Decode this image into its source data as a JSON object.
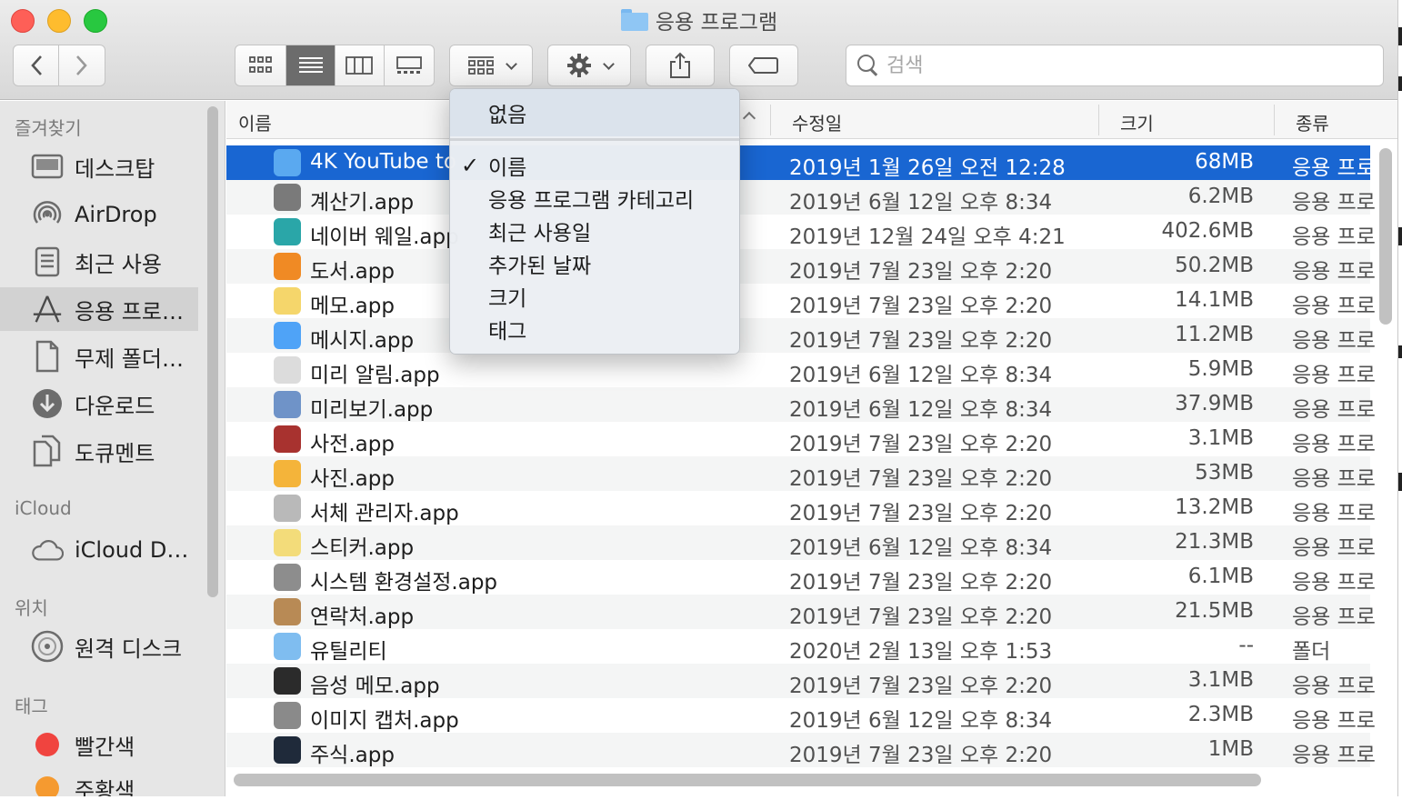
{
  "window": {
    "title": "응용 프로그램"
  },
  "toolbar": {
    "back_label": "‹",
    "forward_label": "›",
    "search_placeholder": "검색"
  },
  "sidebar": {
    "sections": {
      "favorites": "즐겨찾기",
      "icloud": "iCloud",
      "locations": "위치",
      "tags": "태그"
    },
    "favorites": [
      {
        "label": "데스크탑",
        "icon": "desktop-icon"
      },
      {
        "label": "AirDrop",
        "icon": "airdrop-icon"
      },
      {
        "label": "최근 사용",
        "icon": "recents-icon"
      },
      {
        "label": "응용 프로…",
        "icon": "applications-icon"
      },
      {
        "label": "무제 폴더…",
        "icon": "document-icon"
      },
      {
        "label": "다운로드",
        "icon": "downloads-icon"
      },
      {
        "label": "도큐멘트",
        "icon": "documents-icon"
      }
    ],
    "icloud": [
      {
        "label": "iCloud D…",
        "icon": "cloud-icon"
      }
    ],
    "locations": [
      {
        "label": "원격 디스크",
        "icon": "disc-icon"
      }
    ],
    "tags": [
      {
        "label": "빨간색",
        "color": "#f0443f"
      },
      {
        "label": "주황색",
        "color": "#f59a30"
      }
    ]
  },
  "columns": {
    "name": "이름",
    "modified": "수정일",
    "size": "크기",
    "kind": "종류"
  },
  "files": [
    {
      "name": "4K YouTube to",
      "date": "2019년 1월 26일 오전 12:28",
      "size": "68MB",
      "kind": "응용 프로",
      "color": "#5aa9f0"
    },
    {
      "name": "계산기.app",
      "date": "2019년 6월 12일 오후 8:34",
      "size": "6.2MB",
      "kind": "응용 프로",
      "color": "#7a7a7a"
    },
    {
      "name": "네이버 웨일.app",
      "date": "2019년 12월 24일 오후 4:21",
      "size": "402.6MB",
      "kind": "응용 프로",
      "color": "#2aa6a8"
    },
    {
      "name": "도서.app",
      "date": "2019년 7월 23일 오후 2:20",
      "size": "50.2MB",
      "kind": "응용 프로",
      "color": "#f08a24"
    },
    {
      "name": "메모.app",
      "date": "2019년 7월 23일 오후 2:20",
      "size": "14.1MB",
      "kind": "응용 프로",
      "color": "#f5d66b"
    },
    {
      "name": "메시지.app",
      "date": "2019년 7월 23일 오후 2:20",
      "size": "11.2MB",
      "kind": "응용 프로",
      "color": "#4fa3f7"
    },
    {
      "name": "미리 알림.app",
      "date": "2019년 6월 12일 오후 8:34",
      "size": "5.9MB",
      "kind": "응용 프로",
      "color": "#dcdcdc"
    },
    {
      "name": "미리보기.app",
      "date": "2019년 6월 12일 오후 8:34",
      "size": "37.9MB",
      "kind": "응용 프로",
      "color": "#6f93c8"
    },
    {
      "name": "사전.app",
      "date": "2019년 7월 23일 오후 2:20",
      "size": "3.1MB",
      "kind": "응용 프로",
      "color": "#a8322f"
    },
    {
      "name": "사진.app",
      "date": "2019년 7월 23일 오후 2:20",
      "size": "53MB",
      "kind": "응용 프로",
      "color": "#f4b43a"
    },
    {
      "name": "서체 관리자.app",
      "date": "2019년 7월 23일 오후 2:20",
      "size": "13.2MB",
      "kind": "응용 프로",
      "color": "#b9b9b9"
    },
    {
      "name": "스티커.app",
      "date": "2019년 6월 12일 오후 8:34",
      "size": "21.3MB",
      "kind": "응용 프로",
      "color": "#f3dc7a"
    },
    {
      "name": "시스템 환경설정.app",
      "date": "2019년 7월 23일 오후 2:20",
      "size": "6.1MB",
      "kind": "응용 프로",
      "color": "#8d8d8d"
    },
    {
      "name": "연락처.app",
      "date": "2019년 7월 23일 오후 2:20",
      "size": "21.5MB",
      "kind": "응용 프로",
      "color": "#b88a55"
    },
    {
      "name": "유틸리티",
      "date": "2020년 2월 13일 오후 1:53",
      "size": "--",
      "kind": "폴더",
      "color": "#7fbdf0"
    },
    {
      "name": "음성 메모.app",
      "date": "2019년 7월 23일 오후 2:20",
      "size": "3.1MB",
      "kind": "응용 프로",
      "color": "#2b2b2b"
    },
    {
      "name": "이미지 캡처.app",
      "date": "2019년 6월 12일 오후 8:34",
      "size": "2.3MB",
      "kind": "응용 프로",
      "color": "#8a8a8a"
    },
    {
      "name": "주식.app",
      "date": "2019년 7월 23일 오후 2:20",
      "size": "1MB",
      "kind": "응용 프로",
      "color": "#1f2a3a"
    }
  ],
  "group_menu": {
    "items": [
      "없음",
      "이름",
      "응용 프로그램 카테고리",
      "최근 사용일",
      "추가된 날짜",
      "크기",
      "태그"
    ],
    "checked": "✓"
  }
}
